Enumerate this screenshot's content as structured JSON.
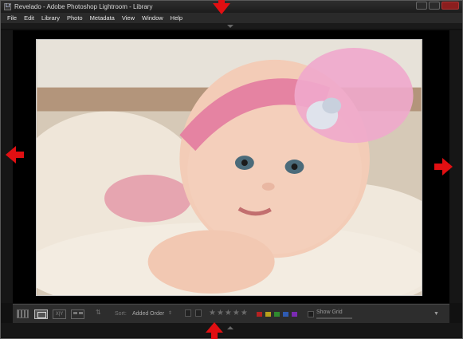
{
  "window": {
    "title": "Revelado - Adobe Photoshop Lightroom - Library",
    "app_icon_letters": "Lr"
  },
  "menu": [
    "File",
    "Edit",
    "Library",
    "Photo",
    "Metadata",
    "View",
    "Window",
    "Help"
  ],
  "toolbar": {
    "sort_label": "Sort:",
    "sort_value": "Added Order",
    "compare_label": "X|Y",
    "stars": "★★★★★",
    "color_labels": [
      "#b52222",
      "#b8a11c",
      "#2f8b2f",
      "#2f5bb2",
      "#7b2ab2"
    ],
    "show_grid_label": "Show Grid"
  },
  "photo": {
    "subject": "baby-with-pink-feather-headband"
  },
  "annotations": {
    "arrow_color": "#e10f12"
  }
}
